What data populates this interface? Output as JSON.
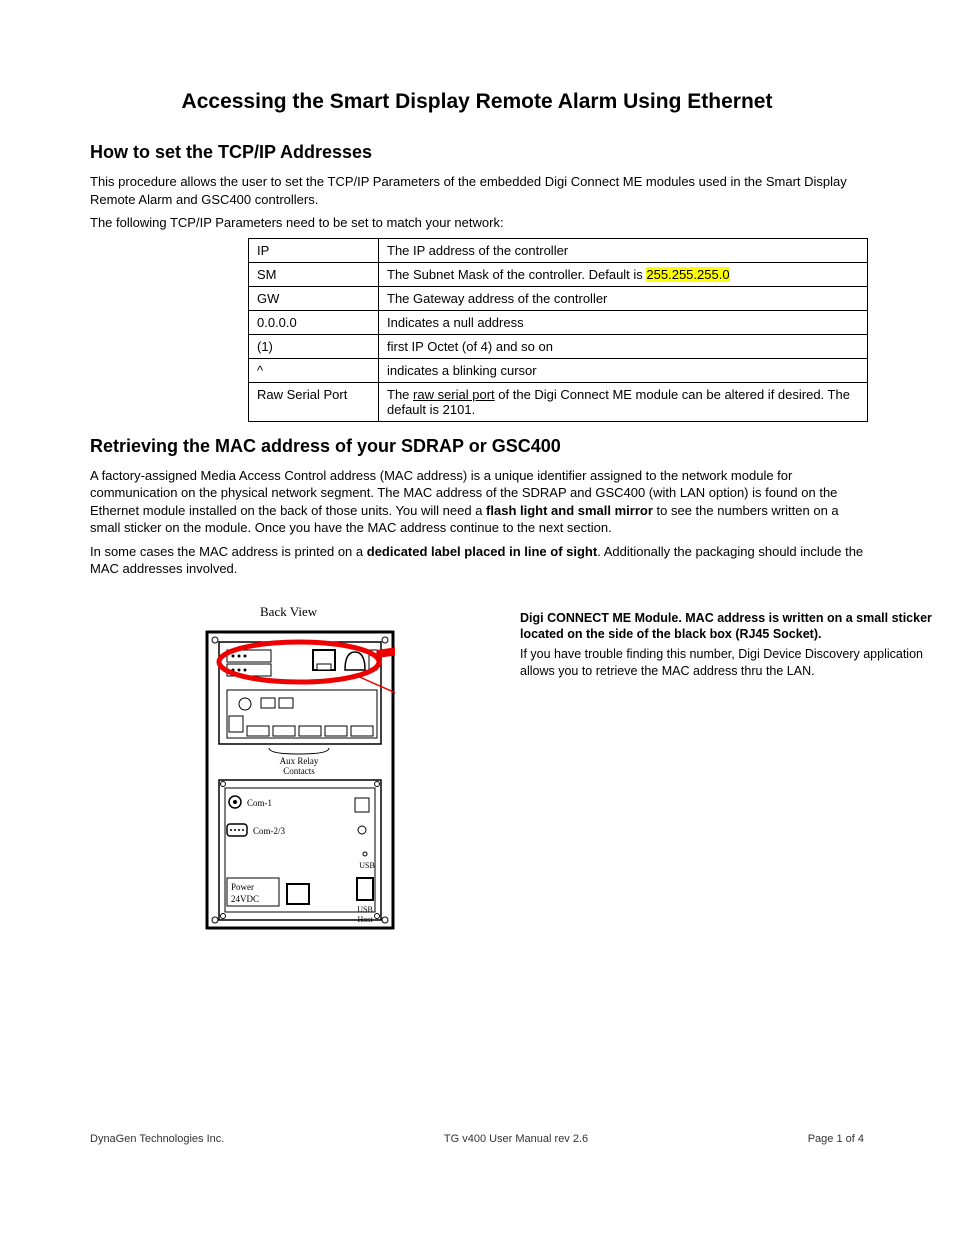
{
  "title": "Accessing the Smart Display Remote Alarm Using Ethernet",
  "section1": {
    "heading": "How to set the TCP/IP Addresses",
    "para1": "This procedure allows the user to set the TCP/IP Parameters of the embedded Digi Connect ME modules used in the Smart Display Remote Alarm and GSC400 controllers.",
    "para2": "The following TCP/IP Parameters need to be set to match your network:",
    "table": [
      {
        "k": "IP",
        "v": "The IP address of the controller"
      },
      {
        "k": "SM",
        "v_pre": "The Subnet Mask of the controller. Default is ",
        "v_hl": "255.255.255.0"
      },
      {
        "k": "GW",
        "v": "The Gateway address of the controller"
      },
      {
        "k": "0.0.0.0",
        "v": "Indicates a null address"
      },
      {
        "k": "(1)",
        "v": "first IP Octet (of 4) and so on"
      },
      {
        "k": "^",
        "v": "indicates a blinking cursor"
      },
      {
        "k": "Raw Serial Port",
        "v_pre": "The ",
        "v_u": "raw serial port",
        "v_post": " of the Digi Connect ME module can be altered if desired. The default is 2101."
      }
    ]
  },
  "section2": {
    "heading": "Retrieving the MAC address of your SDRAP or GSC400",
    "para1_pre": "A factory-assigned Media Access Control address (MAC address) is a unique identifier assigned to the network module for communication on the physical network segment. The MAC address of the SDRAP and GSC400 (with LAN option) is found on the Ethernet module installed on the back of those units. You will need a ",
    "para1_bold": "flash light and small mirror",
    "para1_post": " to see the numbers written on a small sticker on the module. Once you have the MAC address continue to the next section.",
    "para2_pre": "In some cases the MAC address is printed on a ",
    "para2_bold": "dedicated label placed in line of sight",
    "para2_post": ". Additionally the packaging should include the MAC addresses involved."
  },
  "diagram": {
    "back_view": "Back View",
    "aux_relay": "Aux Relay",
    "contacts": "Contacts",
    "com1": "Com-1",
    "com23": "Com-2/3",
    "power": "Power",
    "vdc": "24VDC",
    "usb": "USB",
    "host": "Host",
    "callout_lead": "Digi CONNECT ME Module. MAC address is written on a small sticker located on the side of the black box (RJ45 Socket).",
    "callout_body": "If you have trouble finding this number, Digi Device Discovery application allows you to retrieve the MAC address thru the LAN."
  },
  "footer": {
    "left": "DynaGen Technologies Inc.",
    "center": "TG v400 User Manual rev 2.6",
    "right": "Page 1 of 4"
  }
}
